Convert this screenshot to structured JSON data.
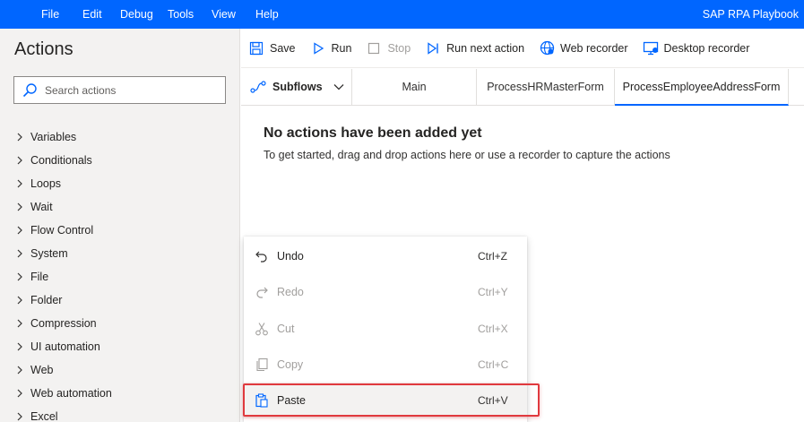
{
  "menubar": {
    "items": [
      "File",
      "Edit",
      "Debug",
      "Tools",
      "View",
      "Help"
    ],
    "app_title": "SAP RPA Playbook",
    "bg_color": "#0066ff"
  },
  "actions_pane": {
    "title": "Actions",
    "search": {
      "placeholder": "Search actions",
      "icon": "search-icon"
    },
    "categories": [
      "Variables",
      "Conditionals",
      "Loops",
      "Wait",
      "Flow Control",
      "System",
      "File",
      "Folder",
      "Compression",
      "UI automation",
      "Web",
      "Web automation",
      "Excel"
    ]
  },
  "toolbar": {
    "save": "Save",
    "run": "Run",
    "stop": "Stop",
    "run_next": "Run next action",
    "web_recorder": "Web recorder",
    "desktop_recorder": "Desktop recorder"
  },
  "tabs": {
    "subflows": "Subflows",
    "items": [
      {
        "label": "Main",
        "active": false
      },
      {
        "label": "ProcessHRMasterForm",
        "active": false
      },
      {
        "label": "ProcessEmployeeAddressForm",
        "active": true
      }
    ]
  },
  "canvas": {
    "empty_title": "No actions have been added yet",
    "empty_subtitle": "To get started, drag and drop actions here or use a recorder to capture the actions"
  },
  "context_menu": {
    "items": [
      {
        "label": "Undo",
        "shortcut": "Ctrl+Z",
        "enabled": true,
        "icon": "undo-icon"
      },
      {
        "label": "Redo",
        "shortcut": "Ctrl+Y",
        "enabled": false,
        "icon": "redo-icon"
      },
      {
        "label": "Cut",
        "shortcut": "Ctrl+X",
        "enabled": false,
        "icon": "cut-icon"
      },
      {
        "label": "Copy",
        "shortcut": "Ctrl+C",
        "enabled": false,
        "icon": "copy-icon"
      },
      {
        "label": "Paste",
        "shortcut": "Ctrl+V",
        "enabled": true,
        "icon": "paste-icon"
      }
    ],
    "highlight_color": "#e0393e"
  }
}
